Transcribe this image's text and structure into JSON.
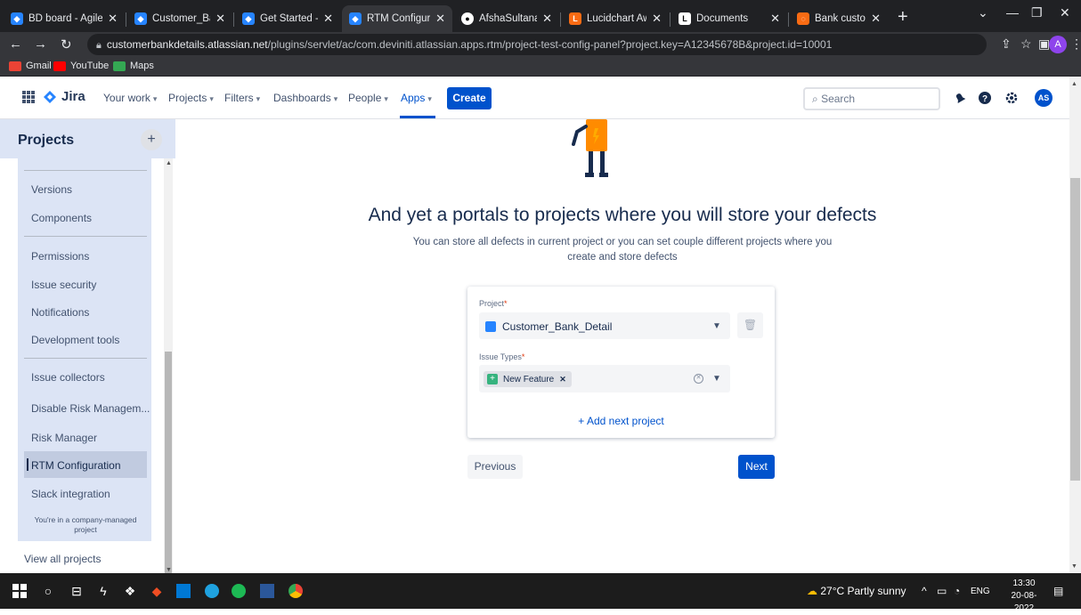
{
  "browser": {
    "tabs": [
      {
        "label": "BD board - Agile",
        "color": "#2684ff",
        "active": false
      },
      {
        "label": "Customer_Bank_D",
        "color": "#2684ff",
        "active": false
      },
      {
        "label": "Get Started - Jira",
        "color": "#2684ff",
        "active": false
      },
      {
        "label": "RTM Configuratio",
        "color": "#2684ff",
        "active": true
      },
      {
        "label": "AfshaSultanaa/Cu",
        "color": "#ffffff",
        "active": false
      },
      {
        "label": "Lucidchart Aws -",
        "color": "#f96b13",
        "active": false
      },
      {
        "label": "Documents",
        "color": "#ffffff",
        "active": false
      },
      {
        "label": "Bank customer d",
        "color": "#f96b13",
        "active": false
      }
    ],
    "url_host": "customerbankdetails.atlassian.net",
    "url_path": "/plugins/servlet/ac/com.deviniti.atlassian.apps.rtm/project-test-config-panel?project.key=A12345678B&project.id=10001",
    "profile_initial": "A",
    "bookmarks": [
      {
        "label": "Gmail",
        "color": "#ea4335"
      },
      {
        "label": "YouTube",
        "color": "#ff0000"
      },
      {
        "label": "Maps",
        "color": "#34a853"
      }
    ]
  },
  "jira_nav": {
    "brand": "Jira",
    "items": [
      {
        "label": "Your work"
      },
      {
        "label": "Projects"
      },
      {
        "label": "Filters"
      },
      {
        "label": "Dashboards"
      },
      {
        "label": "People"
      },
      {
        "label": "Apps"
      }
    ],
    "create_label": "Create",
    "search_placeholder": "Search",
    "user_initials": "AS"
  },
  "sidebar": {
    "title": "Projects",
    "items": [
      {
        "label": "Versions"
      },
      {
        "label": "Components"
      },
      {
        "label": "Permissions"
      },
      {
        "label": "Issue security"
      },
      {
        "label": "Notifications"
      },
      {
        "label": "Development tools"
      },
      {
        "label": "Issue collectors"
      },
      {
        "label": "Disable Risk Managem..."
      },
      {
        "label": "Risk Manager"
      },
      {
        "label": "RTM Configuration"
      },
      {
        "label": "Slack integration"
      }
    ],
    "note": "You're in a company-managed project",
    "view_all": "View all projects"
  },
  "main": {
    "title": "And yet a portals to projects where you will store your defects",
    "subtitle": "You can store all defects in current project or you can set couple different projects where you create and store defects",
    "project_label": "Project",
    "project_value": "Customer_Bank_Detail",
    "issue_types_label": "Issue Types",
    "issue_type_tag": "New Feature",
    "add_next_project": "+ Add next project",
    "previous_label": "Previous",
    "next_label": "Next"
  },
  "taskbar": {
    "weather": "27°C  Partly sunny",
    "lang": "ENG",
    "time": "13:30",
    "date": "20-08-2022"
  },
  "colors": {
    "accent": "#0052cc",
    "sidebar_bg": "#dce4f5"
  }
}
